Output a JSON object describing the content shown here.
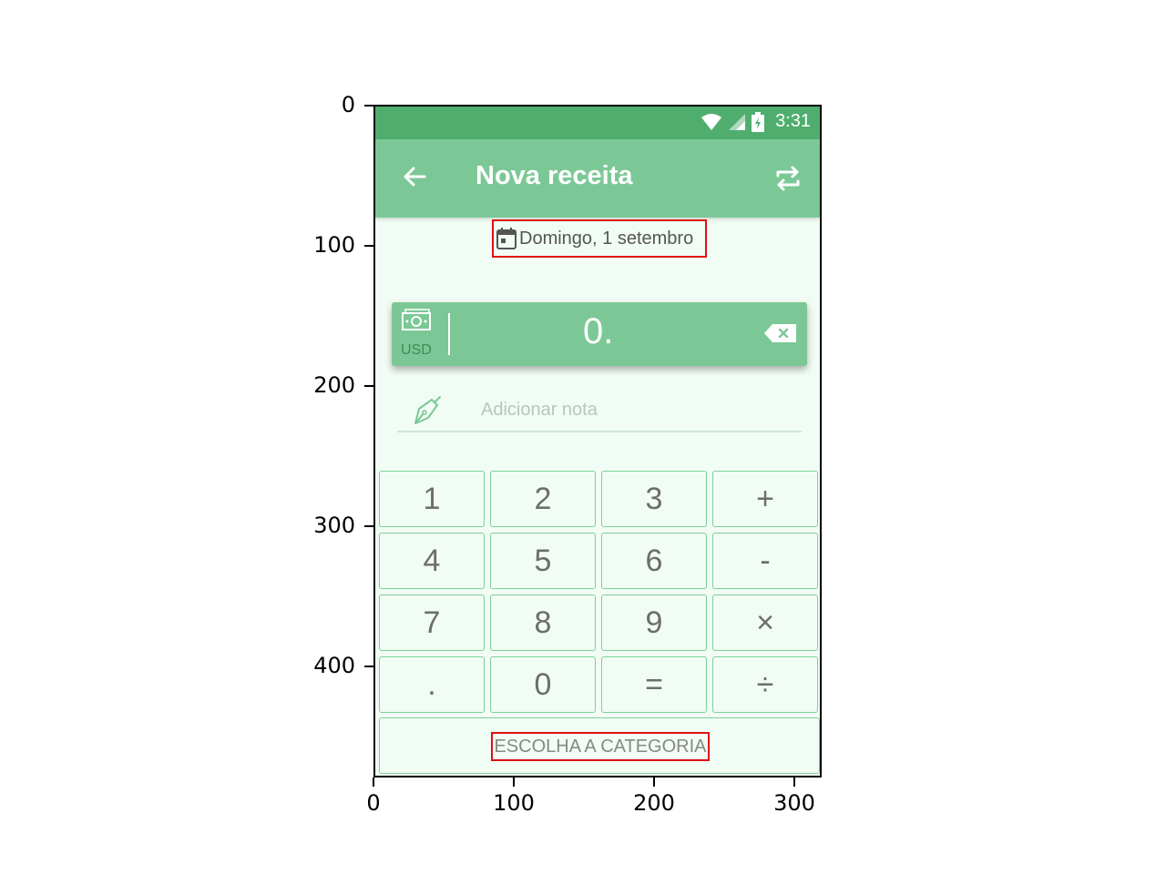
{
  "axes": {
    "y_ticks": [
      "0",
      "100",
      "200",
      "300",
      "400"
    ],
    "x_ticks": [
      "0",
      "100",
      "200",
      "300"
    ]
  },
  "status_bar": {
    "time": "3:31",
    "icons": [
      "wifi-icon",
      "signal-icon",
      "battery-charging-icon"
    ]
  },
  "app_bar": {
    "title": "Nova receita",
    "back_icon": "arrow-left-icon",
    "action_icon": "repeat-icon"
  },
  "date": {
    "icon": "calendar-icon",
    "label": "Domingo, 1 setembro"
  },
  "amount": {
    "currency": "USD",
    "value": "0.",
    "icons": [
      "money-icon",
      "backspace-icon"
    ]
  },
  "note": {
    "placeholder": "Adicionar nota",
    "icon": "pen-icon"
  },
  "keypad": {
    "rows": [
      [
        "1",
        "2",
        "3",
        "+"
      ],
      [
        "4",
        "5",
        "6",
        "-"
      ],
      [
        "7",
        "8",
        "9",
        "×"
      ],
      [
        ".",
        "0",
        "=",
        "÷"
      ]
    ]
  },
  "category_button": {
    "label": "ESCOLHA A CATEGORIA"
  },
  "colors": {
    "status_bar": "#4fae6e",
    "app_bar": "#7bc896",
    "background": "#f1fcf4",
    "highlight": "#e01010"
  }
}
